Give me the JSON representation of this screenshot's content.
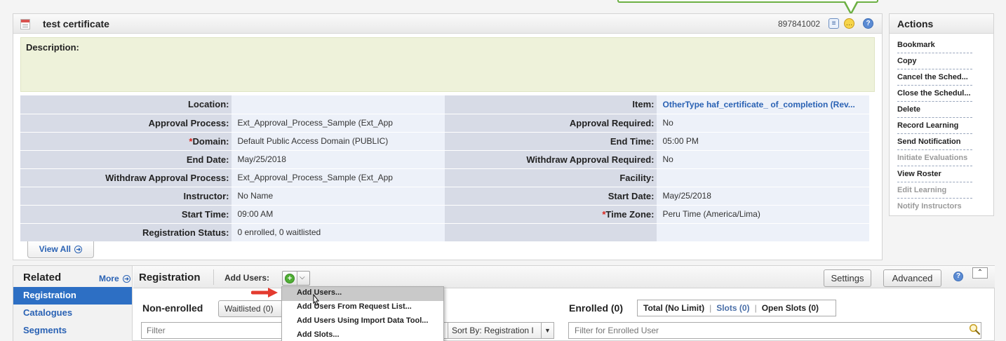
{
  "header": {
    "title": "test certificate",
    "item_id": "897841002"
  },
  "description": {
    "label": "Description:"
  },
  "details": {
    "rows": [
      {
        "l1": "Location:",
        "v1": "",
        "l2": "Item:",
        "v2": "OtherType haf_certificate_ of_completion (Rev..."
      },
      {
        "l1": "Approval Process:",
        "v1": "Ext_Approval_Process_Sample (Ext_App",
        "l2": "Approval Required:",
        "v2": "No"
      },
      {
        "l1": "Domain:",
        "v1": "Default Public Access Domain (PUBLIC)",
        "l2": "End Time:",
        "v2": "05:00 PM"
      },
      {
        "l1": "End Date:",
        "v1": "May/25/2018",
        "l2": "Withdraw Approval Required:",
        "v2": "No"
      },
      {
        "l1": "Withdraw Approval Process:",
        "v1": "Ext_Approval_Process_Sample (Ext_App",
        "l2": "Facility:",
        "v2": ""
      },
      {
        "l1": "Instructor:",
        "v1": "No Name",
        "l2": "Start Date:",
        "v2": "May/25/2018"
      },
      {
        "l1": "Start Time:",
        "v1": "09:00 AM",
        "l2": "Time Zone:",
        "v2": "Peru Time (America/Lima)"
      },
      {
        "l1": "Registration Status:",
        "v1": "0 enrolled, 0 waitlisted",
        "l2": "",
        "v2": ""
      }
    ],
    "required_marker": "*"
  },
  "view_all_label": "View All",
  "actions": {
    "title": "Actions",
    "items": [
      {
        "label": "Bookmark",
        "enabled": true
      },
      {
        "label": "Copy",
        "enabled": true
      },
      {
        "label": "Cancel the Sched...",
        "enabled": true
      },
      {
        "label": "Close the Schedul...",
        "enabled": true
      },
      {
        "label": "Delete",
        "enabled": true
      },
      {
        "label": "Record Learning",
        "enabled": true
      },
      {
        "label": "Send Notification",
        "enabled": true
      },
      {
        "label": "Initiate Evaluations",
        "enabled": false
      },
      {
        "label": "View Roster",
        "enabled": true
      },
      {
        "label": "Edit Learning",
        "enabled": false
      },
      {
        "label": "Notify Instructors",
        "enabled": false
      }
    ]
  },
  "related": {
    "title": "Related",
    "more_label": "More",
    "items": [
      "Registration",
      "Catalogues",
      "Segments"
    ]
  },
  "registration": {
    "title": "Registration",
    "add_users_label": "Add Users:",
    "settings_label": "Settings",
    "advanced_label": "Advanced",
    "non_enrolled_title": "Non-enrolled",
    "waitlisted_label": "Waitlisted (0)",
    "filter_placeholder": "Filter",
    "sort_by_label": "Sort By: Registration I",
    "enrolled_title": "Enrolled (0)",
    "enrolled_tabs": {
      "total": "Total (No Limit)",
      "slots": "Slots (0)",
      "open_slots": "Open Slots (0)"
    },
    "enrolled_filter_placeholder": "Filter for Enrolled User"
  },
  "add_users_menu": {
    "options": [
      "Add Users...",
      "Add Users From Request List...",
      "Add Users Using Import Data Tool...",
      "Add Slots..."
    ]
  },
  "colors": {
    "accent": "#2d6fc4",
    "link": "#2a62b4",
    "description_bg": "#eef2da",
    "required": "#d9241c",
    "callout": "#6cb043"
  }
}
